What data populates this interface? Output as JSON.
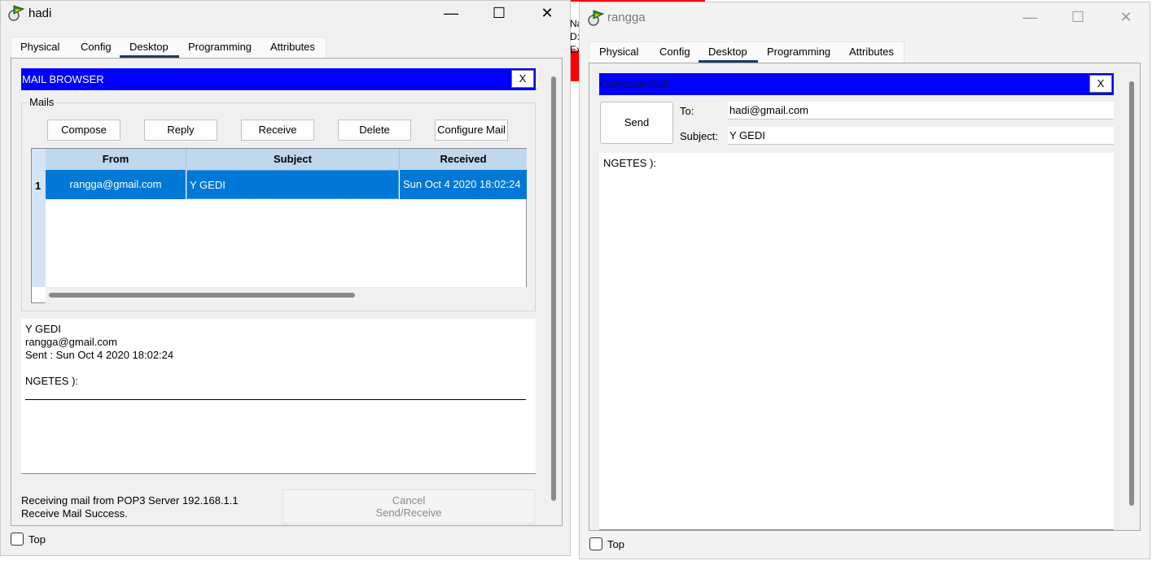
{
  "left_window": {
    "title": "hadi",
    "controls": {
      "minimize": "—",
      "maximize": "☐",
      "close": "✕"
    },
    "tabs": [
      "Physical",
      "Config",
      "Desktop",
      "Programming",
      "Attributes"
    ],
    "active_tab": "Desktop",
    "mail_browser": {
      "title": "MAIL BROWSER",
      "close_label": "X",
      "group_label": "Mails",
      "buttons": {
        "compose": "Compose",
        "reply": "Reply",
        "receive": "Receive",
        "delete": "Delete",
        "configure": "Configure Mail"
      },
      "table": {
        "headers": [
          "From",
          "Subject",
          "Received"
        ],
        "rows": [
          {
            "num": "1",
            "from": "rangga@gmail.com",
            "subject": "Y GEDI",
            "received": "Sun Oct 4 2020 18:02:24"
          }
        ]
      },
      "preview": {
        "subject": "Y GEDI",
        "from": "rangga@gmail.com",
        "sent": "Sent : Sun Oct 4 2020 18:02:24",
        "body": "NGETES ):"
      },
      "status": {
        "line1": "Receiving mail from POP3 Server 192.168.1.1",
        "line2": "Receive Mail Success."
      },
      "cancel_button": {
        "line1": "Cancel",
        "line2": "Send/Receive"
      }
    },
    "top_label": "Top"
  },
  "right_window": {
    "title": "rangga",
    "controls": {
      "minimize": "—",
      "maximize": "☐",
      "close": "✕"
    },
    "tabs": [
      "Physical",
      "Config",
      "Desktop",
      "Programming",
      "Attributes"
    ],
    "active_tab": "Desktop",
    "compose": {
      "title": "Compose Mail",
      "close_label": "X",
      "send_label": "Send",
      "to_label": "To:",
      "to_value": "hadi@gmail.com",
      "subject_label": "Subject:",
      "subject_value": "Y GEDI",
      "body": "NGETES ):"
    },
    "top_label": "Top"
  },
  "background_fragment": {
    "lines": [
      "Na",
      "D:",
      "Ex"
    ]
  },
  "colors": {
    "title_blue": "#0000ff",
    "selection": "#0078d7",
    "header_blue": "#c0d8ee",
    "tab_underline": "#1f3a60",
    "red": "#ff0000"
  }
}
